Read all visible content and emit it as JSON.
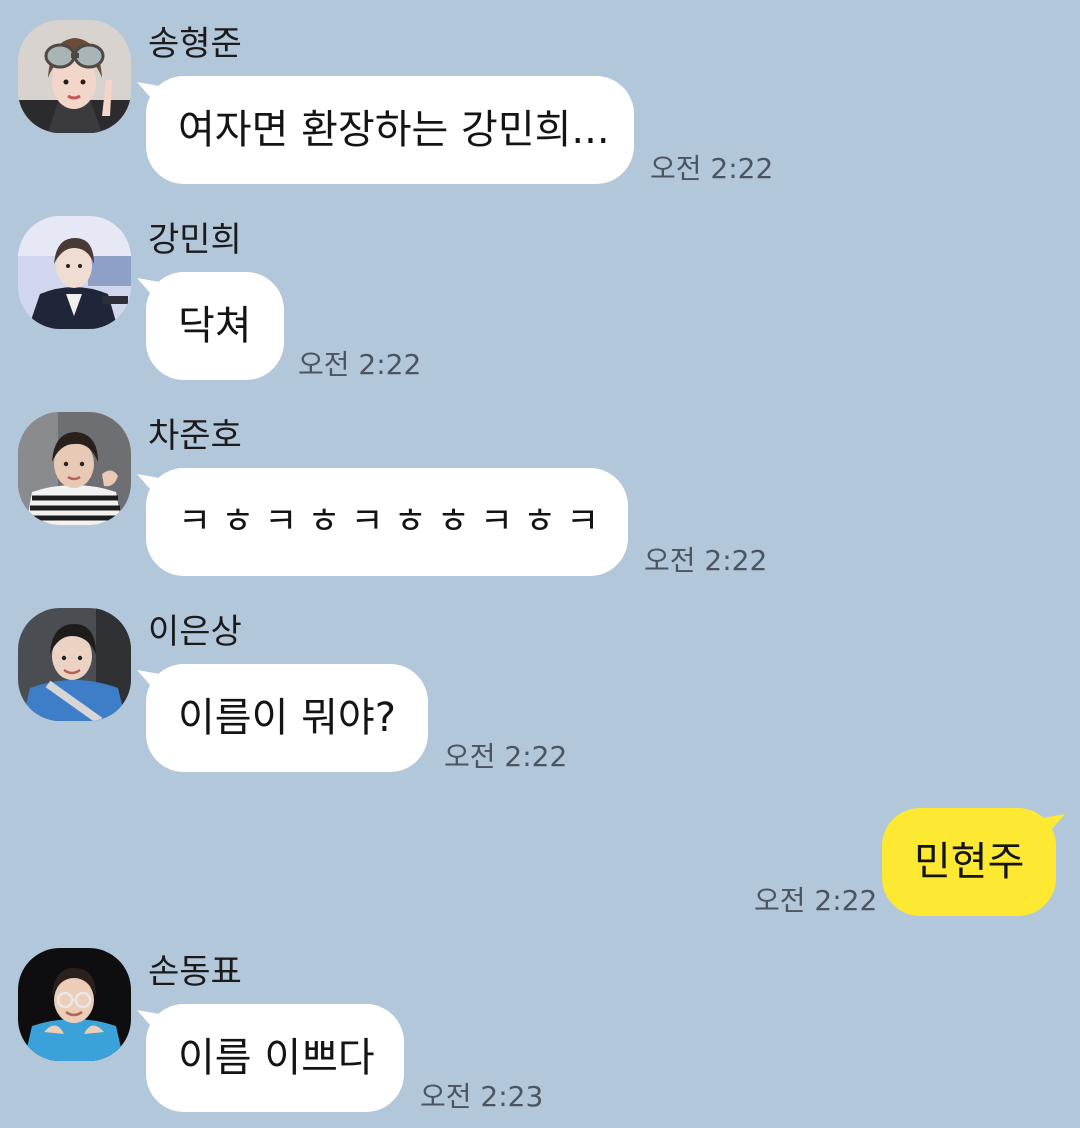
{
  "chat": {
    "messages": [
      {
        "sender": "송형준",
        "text": "여자면 환장하는 강민희...",
        "time": "오전 2:22",
        "avatar_icon": "profile-photo-goggles-icon"
      },
      {
        "sender": "강민희",
        "text": "닥쳐",
        "time": "오전 2:22",
        "avatar_icon": "profile-photo-suit-icon"
      },
      {
        "sender": "차준호",
        "text": "ㅋㅎㅋㅎㅋㅎㅎㅋㅎㅋ",
        "time": "오전 2:22",
        "avatar_icon": "profile-photo-striped-shirt-icon"
      },
      {
        "sender": "이은상",
        "text": "이름이 뭐야?",
        "time": "오전 2:22",
        "avatar_icon": "profile-photo-car-seat-icon"
      },
      {
        "sender": "",
        "text": "민현주",
        "time": "오전 2:22",
        "mine": true
      },
      {
        "sender": "손동표",
        "text": "이름 이쁘다",
        "time": "오전 2:23",
        "avatar_icon": "profile-photo-glasses-icon"
      }
    ]
  },
  "colors": {
    "background": "#b2c7da",
    "incoming_bubble": "#ffffff",
    "outgoing_bubble": "#fee932",
    "time_text": "#4b5561"
  }
}
